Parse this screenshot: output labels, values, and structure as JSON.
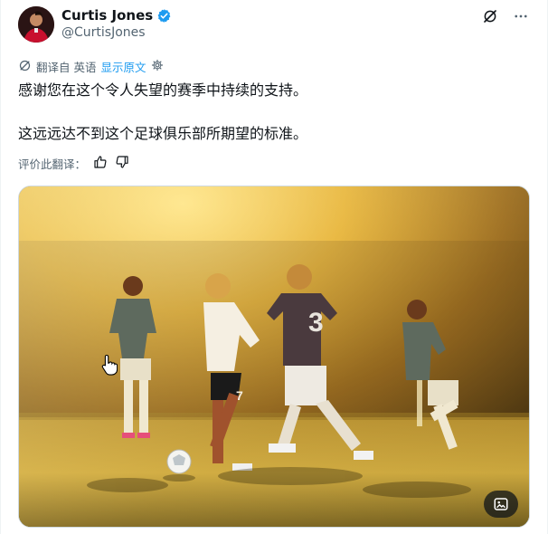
{
  "author": {
    "display_name": "Curtis Jones",
    "handle": "@CurtisJones",
    "verified": true
  },
  "translation": {
    "translated_from": "翻译自 英语",
    "show_original": "显示原文"
  },
  "tweet": {
    "line1": "感谢您在这个令人失望的赛季中持续的支持。",
    "line2": "这远远达不到这个足球俱乐部所期望的标准。"
  },
  "rating": {
    "label": "评价此翻译："
  },
  "media": {
    "players": [
      {
        "shirt": "3"
      },
      {
        "shirt": "7"
      }
    ]
  },
  "colors": {
    "accent": "#1d9bf0",
    "text_secondary": "#536471"
  },
  "icons": {
    "grok": "grok-icon",
    "more": "more-icon",
    "translate": "translate-icon",
    "settings": "settings-icon",
    "thumbs_up": "thumbs-up-icon",
    "thumbs_down": "thumbs-down-icon",
    "alt_edit": "image-edit-icon"
  }
}
